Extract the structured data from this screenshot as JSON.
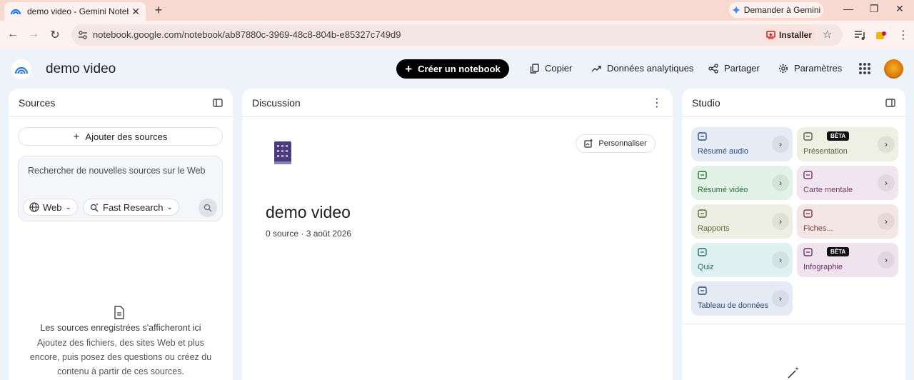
{
  "browser": {
    "tab_title": "demo video - Gemini Notebook",
    "tab_close": "✕",
    "new_tab": "+",
    "gemini_button": "Demander à Gemini",
    "url": "notebook.google.com/notebook/ab87880c-3969-48c8-804b-e85327c749d9",
    "install_label": "Installer"
  },
  "header": {
    "title": "demo video",
    "create_label": "Créer un notebook",
    "copy_label": "Copier",
    "analytics_label": "Données analytiques",
    "share_label": "Partager",
    "settings_label": "Paramètres"
  },
  "sources": {
    "title": "Sources",
    "add_label": "Ajouter des sources",
    "search_placeholder": "Rechercher de nouvelles sources sur le Web",
    "web_chip": "Web",
    "research_chip": "Fast Research",
    "empty_title": "Les sources enregistrées s'afficheront ici",
    "empty_desc": "Ajoutez des fichiers, des sites Web et plus encore, puis posez des questions ou créez du contenu à partir de ces sources."
  },
  "discussion": {
    "title": "Discussion",
    "personalize_label": "Personnaliser",
    "notebook_title": "demo video",
    "meta": "0 source · 3 août 2026"
  },
  "studio": {
    "title": "Studio",
    "tiles": [
      {
        "label": "Résumé audio",
        "bg": "#e6ecf6",
        "color": "#2e4a7d"
      },
      {
        "label": "Présentation",
        "bg": "#eef0e3",
        "color": "#5b5e3c",
        "beta": "BÊTA"
      },
      {
        "label": "Résumé vidéo",
        "bg": "#e2f2e6",
        "color": "#2d6a3c"
      },
      {
        "label": "Carte mentale",
        "bg": "#f1e6ef",
        "color": "#6e3b66"
      },
      {
        "label": "Rapports",
        "bg": "#edefe4",
        "color": "#5b6a3a"
      },
      {
        "label": "Fiches...",
        "bg": "#f5e6e6",
        "color": "#7d3b3b"
      },
      {
        "label": "Quiz",
        "bg": "#e0f1f1",
        "color": "#2b6b6b"
      },
      {
        "label": "Infographie",
        "bg": "#efe4ee",
        "color": "#6b2f63",
        "beta": "BÊTA"
      },
      {
        "label": "Tableau de données",
        "bg": "#e5ebf5",
        "color": "#2e4a7d"
      }
    ]
  }
}
